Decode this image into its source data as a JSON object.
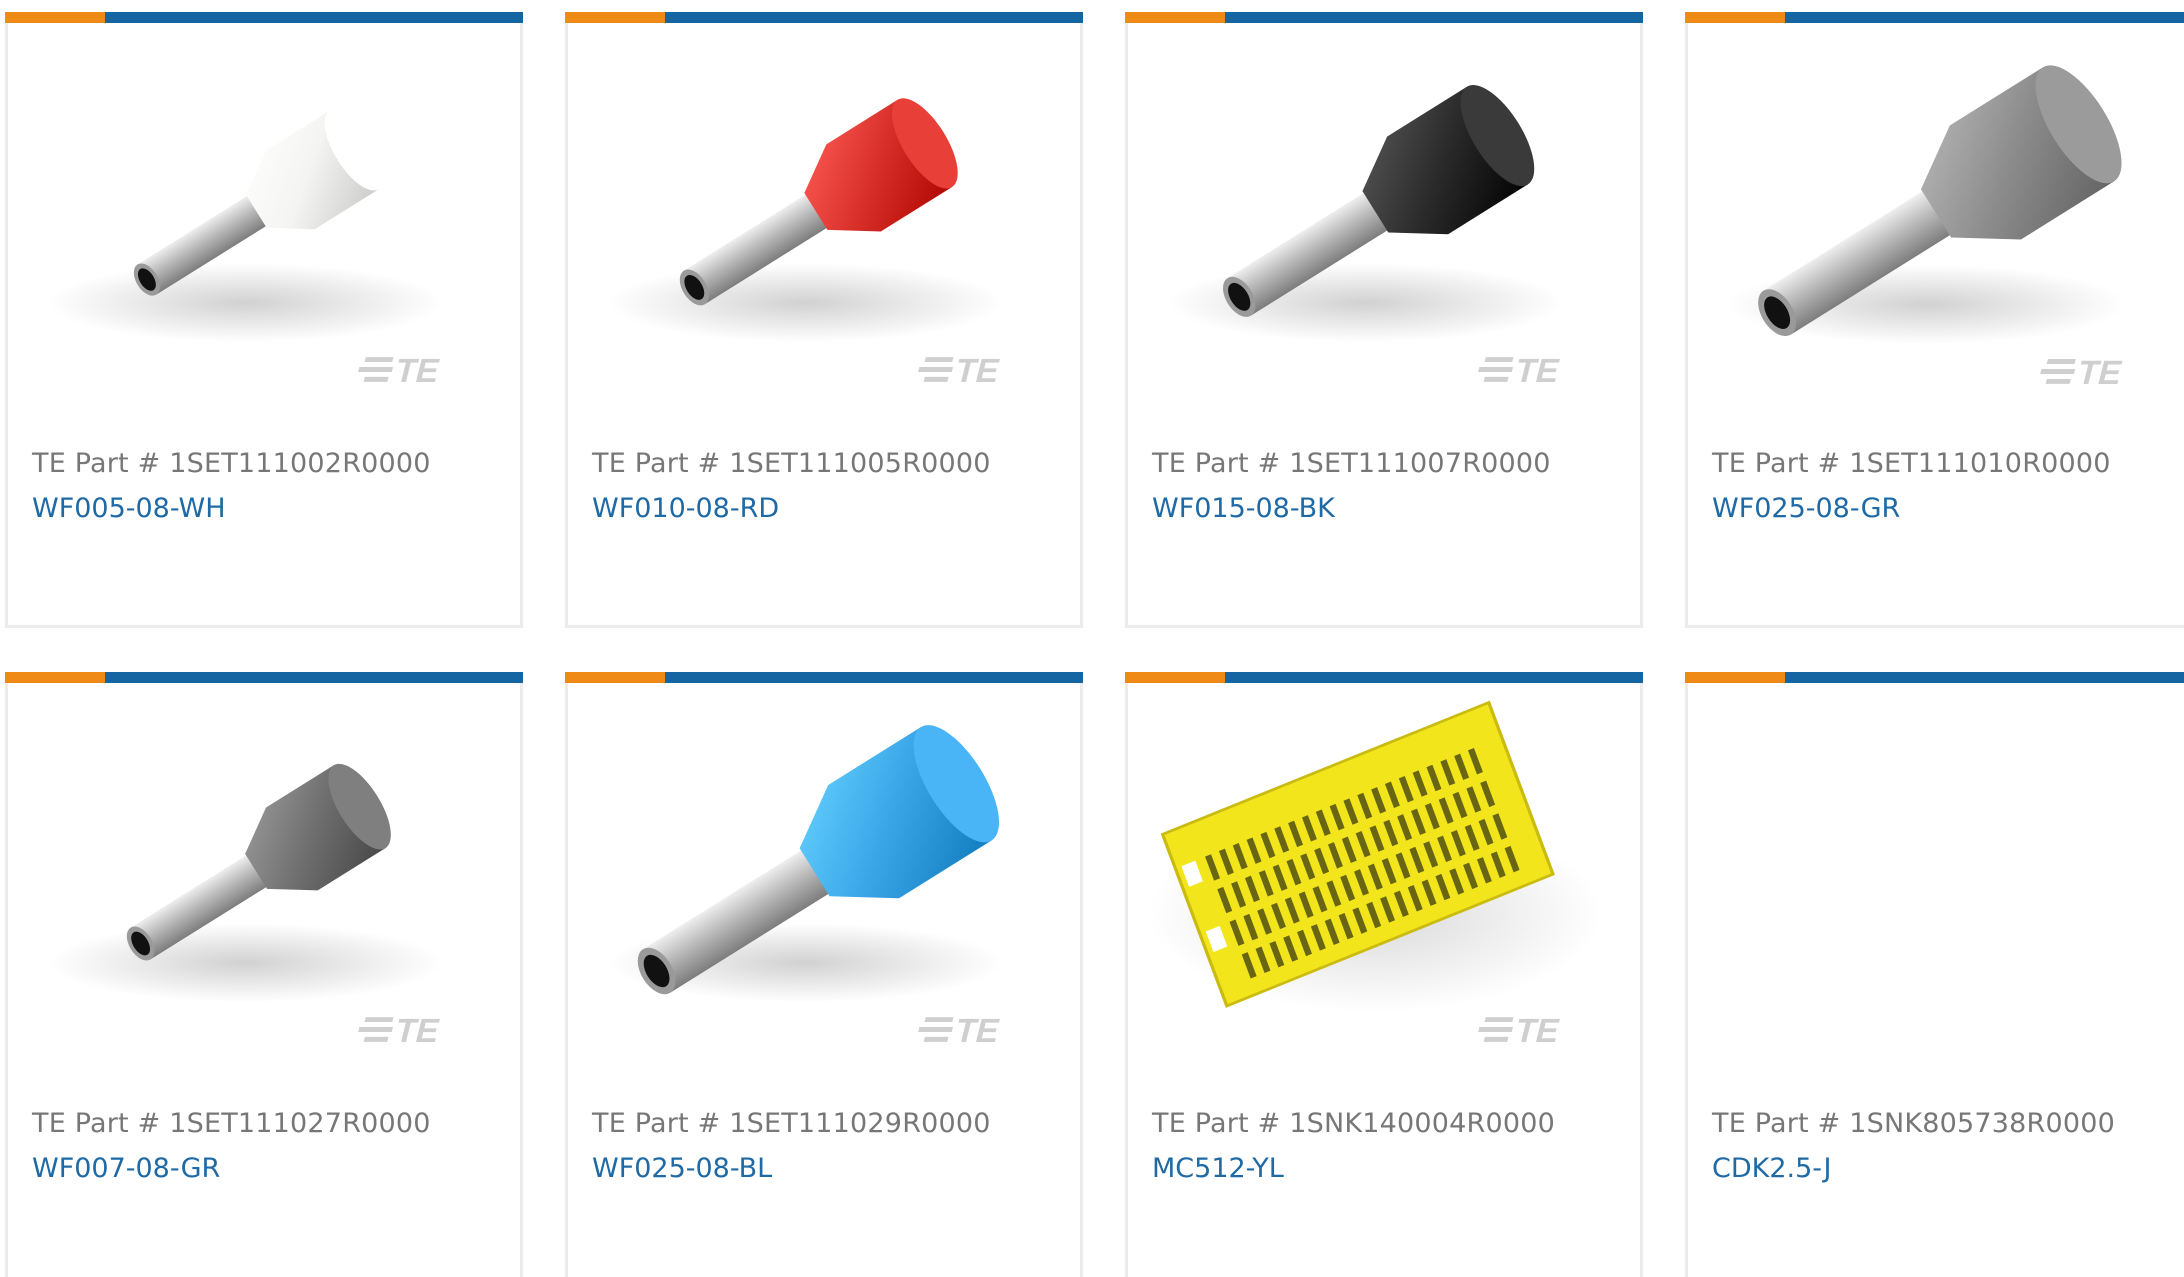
{
  "products": [
    {
      "part_prefix": "TE Part #",
      "part_number": "1SET111002R0000",
      "name": "WF005-08-WH",
      "image": "ferrule-white",
      "sleeve_color": "#f4f4f2",
      "scale": 0.9
    },
    {
      "part_prefix": "TE Part #",
      "part_number": "1SET111005R0000",
      "name": "WF010-08-RD",
      "image": "ferrule-red",
      "sleeve_color": "#d9302a",
      "scale": 1.0
    },
    {
      "part_prefix": "TE Part #",
      "part_number": "1SET111007R0000",
      "name": "WF015-08-BK",
      "image": "ferrule-black",
      "sleeve_color": "#2b2b2b",
      "scale": 1.12
    },
    {
      "part_prefix": "TE Part #",
      "part_number": "1SET111010R0000",
      "name": "WF025-08-GR",
      "image": "ferrule-gray",
      "sleeve_color": "#8c8c8c",
      "scale": 1.3
    },
    {
      "part_prefix": "TE Part #",
      "part_number": "1SET111027R0000",
      "name": "WF007-08-GR",
      "image": "ferrule-dark-gray",
      "sleeve_color": "#707070",
      "scale": 0.95
    },
    {
      "part_prefix": "TE Part #",
      "part_number": "1SET111029R0000",
      "name": "WF025-08-BL",
      "image": "ferrule-blue",
      "sleeve_color": "#3aa6e8",
      "scale": 1.3
    },
    {
      "part_prefix": "TE Part #",
      "part_number": "1SNK140004R0000",
      "name": "MC512-YL",
      "image": "marker-card-yellow",
      "sleeve_color": "#f2e51c",
      "scale": 1.0
    },
    {
      "part_prefix": "TE Part #",
      "part_number": "1SNK805738R0000",
      "name": "CDK2.5-J",
      "image": "none",
      "sleeve_color": "",
      "scale": 1.0
    }
  ],
  "brand": {
    "logo_text": "TE",
    "accent_orange": "#ef8a17",
    "accent_blue": "#1565a3",
    "link_color": "#1f6aa5"
  }
}
